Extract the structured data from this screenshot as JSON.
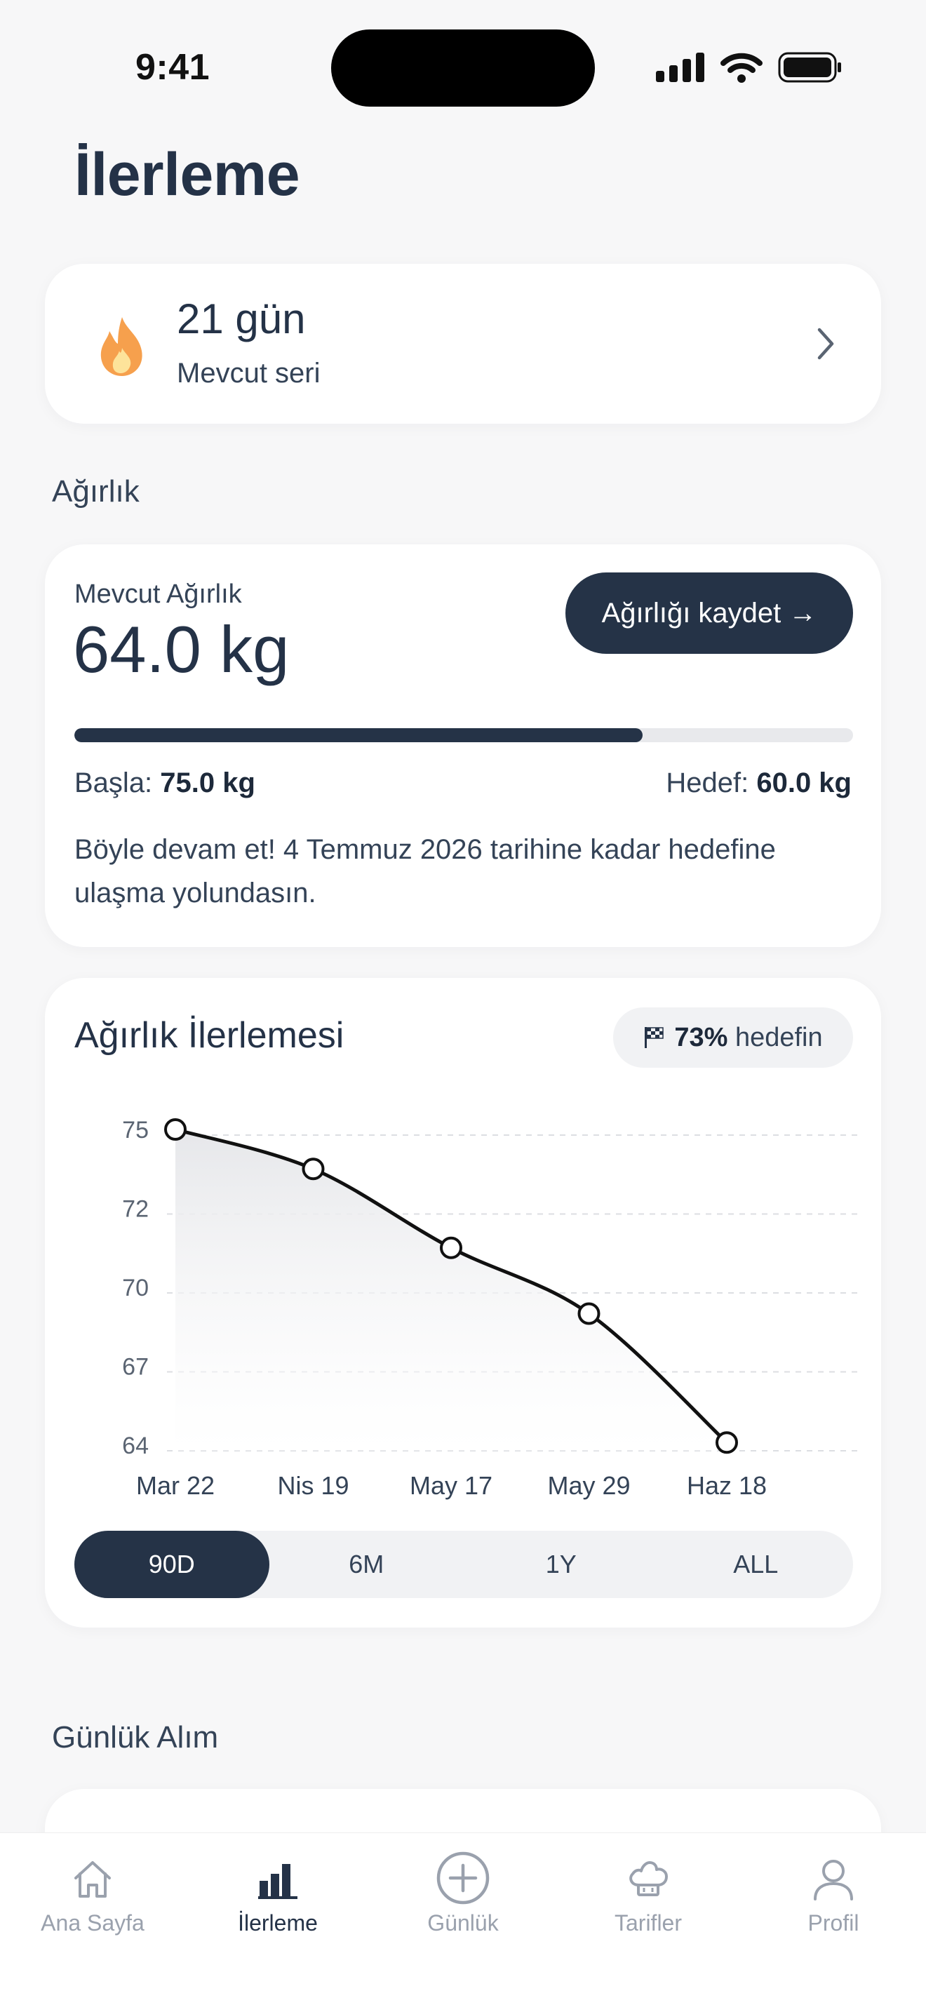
{
  "status_bar": {
    "time": "9:41"
  },
  "page": {
    "title": "İlerleme"
  },
  "streak": {
    "value": "21 gün",
    "label": "Mevcut seri"
  },
  "weight_section": {
    "heading": "Ağırlık",
    "current_label": "Mevcut Ağırlık",
    "current_value": "64.0 kg",
    "log_button": "Ağırlığı kaydet →",
    "progress_fraction": 0.73,
    "start_label": "Başla: ",
    "start_value": "75.0 kg",
    "goal_label": "Hedef: ",
    "goal_value": "60.0 kg",
    "motivation": "Böyle devam et! 4 Temmuz 2026 tarihine kadar hedefine ulaşma yolundasın."
  },
  "chart_section": {
    "title": "Ağırlık İlerlemesi",
    "goal_pill_value": "73%",
    "goal_pill_text": "hedefin",
    "range_tabs": [
      "90D",
      "6M",
      "1Y",
      "ALL"
    ],
    "active_range": "90D"
  },
  "chart_data": {
    "type": "line",
    "x": [
      "Mar 22",
      "Nis 19",
      "May 17",
      "May 29",
      "Haz 18"
    ],
    "series": [
      {
        "values": [
          75.0,
          73.5,
          70.5,
          68.0,
          63.1
        ]
      }
    ],
    "yticks": [
      "75",
      "72",
      "70",
      "67",
      "64"
    ],
    "ylim": [
      63,
      75
    ],
    "grid": true,
    "area_fill": true,
    "line_color": "#111111"
  },
  "daily_section": {
    "heading": "Günlük Alım"
  },
  "tab_bar": {
    "items": [
      {
        "label": "Ana Sayfa",
        "icon": "home-icon"
      },
      {
        "label": "İlerleme",
        "icon": "bar-chart-icon"
      },
      {
        "label": "Günlük",
        "icon": "plus-circle-icon"
      },
      {
        "label": "Tarifler",
        "icon": "chef-hat-icon"
      },
      {
        "label": "Profil",
        "icon": "user-icon"
      }
    ],
    "active": "İlerleme"
  },
  "colors": {
    "primary": "#253347",
    "background": "#f7f7f8",
    "flame": "#f6a04d"
  }
}
